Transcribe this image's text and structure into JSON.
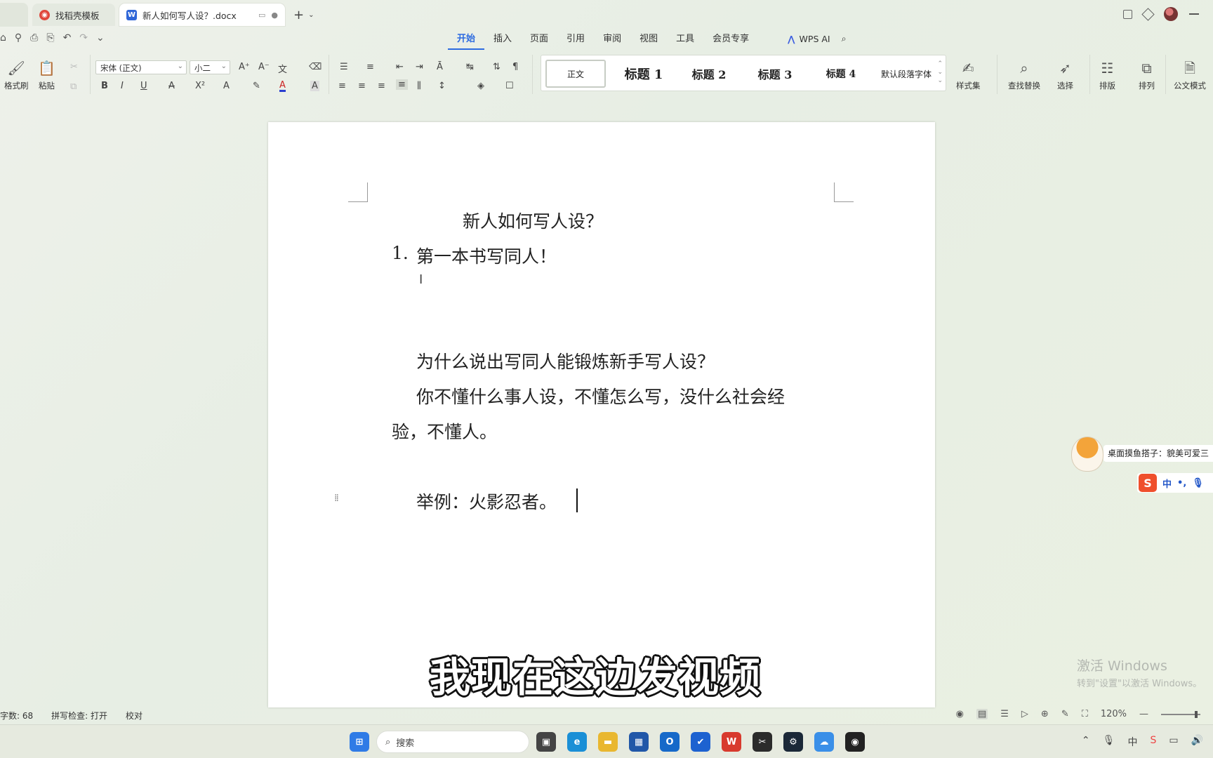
{
  "tabs": [
    {
      "label": "找稻壳模板",
      "icon": "daoke-icon"
    },
    {
      "label": "新人如何写人设？.docx",
      "icon": "word-icon"
    }
  ],
  "menus": [
    "开始",
    "插入",
    "页面",
    "引用",
    "审阅",
    "视图",
    "工具",
    "会员专享"
  ],
  "wps_ai": "WPS AI",
  "ribbon": {
    "format_painter": "格式刷",
    "paste": "粘贴",
    "font_name": "宋体 (正文)",
    "font_size": "小二",
    "styles": [
      "正文",
      "标题 1",
      "标题 2",
      "标题 3",
      "标题 4",
      "默认段落字体"
    ],
    "style_set": "样式集",
    "find_replace": "查找替换",
    "select": "选择",
    "layout": "排版",
    "arrange": "排列",
    "official": "公文模式"
  },
  "document": {
    "title": "新人如何写人设？",
    "list_num": "1.",
    "list_text": "第一本书写同人！",
    "p1": "为什么说出写同人能锻炼新手写人设？",
    "p2_line1": "你不懂什么事人设，不懂怎么写，没什么社会经",
    "p2_line2": "验，不懂人。",
    "p3": "举例：火影忍者。"
  },
  "subtitle": "我现在这边发视频",
  "side_widget": {
    "mascot_text": "桌面摸鱼搭子：貌美可爱三",
    "ime_lang": "中"
  },
  "activation": {
    "line1": "激活 Windows",
    "line2": "转到\"设置\"以激活 Windows。"
  },
  "statusbar": {
    "word_count": "字数: 68",
    "spell_check": "拼写检查: 打开",
    "proofread": "校对",
    "zoom": "120%"
  },
  "taskbar": {
    "search_placeholder": "搜索"
  }
}
